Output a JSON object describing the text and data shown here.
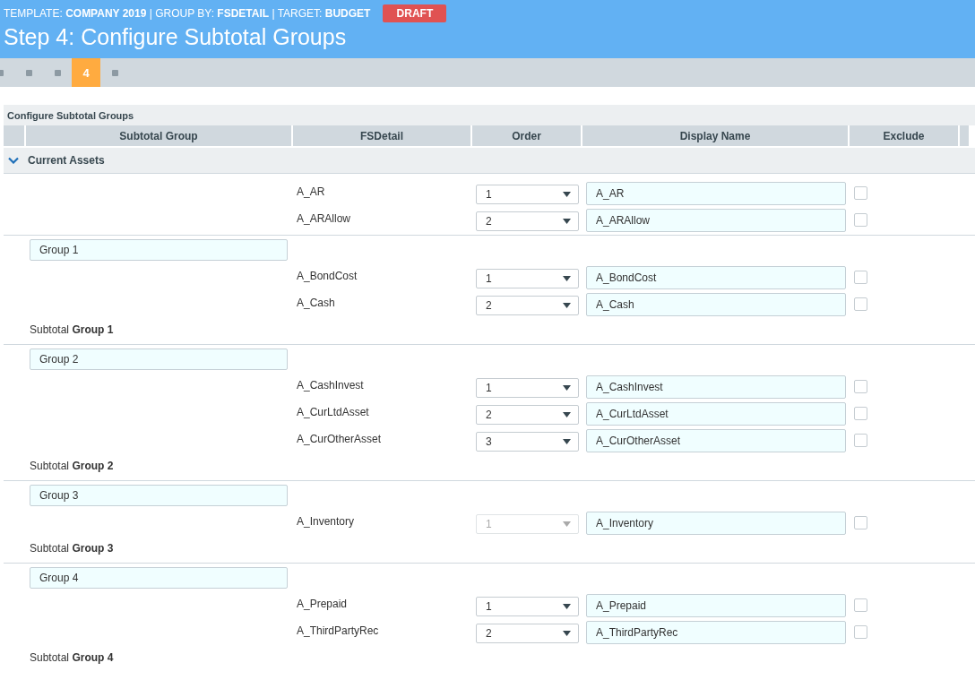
{
  "header": {
    "meta": "TEMPLATE: **COMPANY 2019** | GROUP BY: **FSDETAIL** | TARGET: **BUDGET**",
    "badge": "DRAFT",
    "title": "Step 4: Configure Subtotal Groups"
  },
  "steps": [
    {
      "selected": false
    },
    {
      "selected": false
    },
    {
      "selected": false
    },
    {
      "label": "4",
      "selected": true
    },
    {
      "selected": false
    }
  ],
  "panel": {
    "title": "Configure Subtotal Groups",
    "columns": [
      "Subtotal Group",
      "FSDetail",
      "Order",
      "Display Name",
      "Exclude"
    ],
    "sections": [
      {
        "title": "Current Assets",
        "expanded": true,
        "blocks": [
          {
            "items": [
              {
                "fsdetail": "A_AR",
                "order": "1",
                "order_disabled": false,
                "display_name": "A_AR",
                "exclude": false
              },
              {
                "fsdetail": "A_ARAllow",
                "order": "2",
                "order_disabled": false,
                "display_name": "A_ARAllow",
                "exclude": false
              }
            ]
          },
          {
            "group_name": "Group 1",
            "subtotal": "Subtotal **Group 1**",
            "items": [
              {
                "fsdetail": "A_BondCost",
                "order": "1",
                "order_disabled": false,
                "display_name": "A_BondCost",
                "exclude": false
              },
              {
                "fsdetail": "A_Cash",
                "order": "2",
                "order_disabled": false,
                "display_name": "A_Cash",
                "exclude": false
              }
            ]
          },
          {
            "group_name": "Group 2",
            "subtotal": "Subtotal **Group 2**",
            "items": [
              {
                "fsdetail": "A_CashInvest",
                "order": "1",
                "order_disabled": false,
                "display_name": "A_CashInvest",
                "exclude": false
              },
              {
                "fsdetail": "A_CurLtdAsset",
                "order": "2",
                "order_disabled": false,
                "display_name": "A_CurLtdAsset",
                "exclude": false
              },
              {
                "fsdetail": "A_CurOtherAsset",
                "order": "3",
                "order_disabled": false,
                "display_name": "A_CurOtherAsset",
                "exclude": false
              }
            ]
          },
          {
            "group_name": "Group 3",
            "subtotal": "Subtotal **Group 3**",
            "items": [
              {
                "fsdetail": "A_Inventory",
                "order": "1",
                "order_disabled": true,
                "display_name": "A_Inventory",
                "exclude": false
              }
            ]
          },
          {
            "group_name": "Group 4",
            "subtotal": "Subtotal **Group 4**",
            "items": [
              {
                "fsdetail": "A_Prepaid",
                "order": "1",
                "order_disabled": false,
                "display_name": "A_Prepaid",
                "exclude": false
              },
              {
                "fsdetail": "A_ThirdPartyRec",
                "order": "2",
                "order_disabled": false,
                "display_name": "A_ThirdPartyRec",
                "exclude": false
              }
            ]
          }
        ]
      }
    ]
  }
}
